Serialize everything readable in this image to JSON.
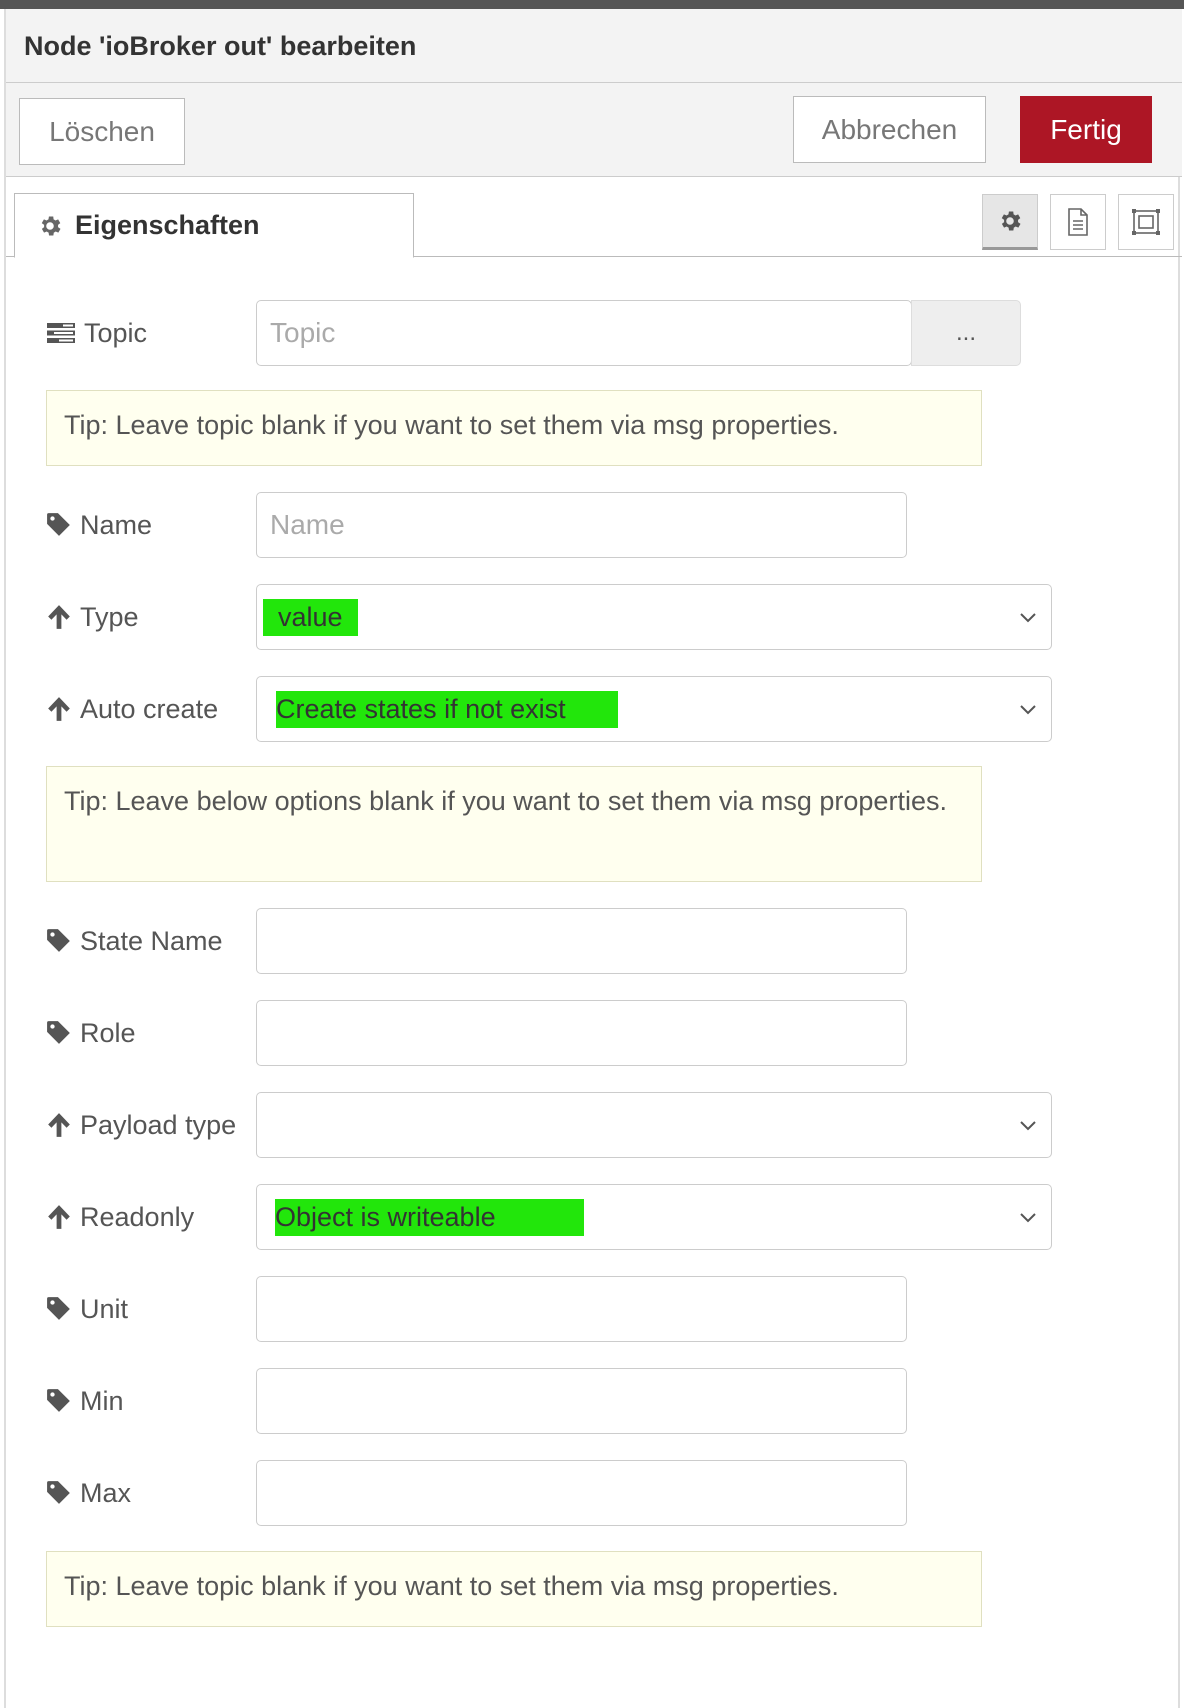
{
  "dialog": {
    "title": "Node 'ioBroker out' bearbeiten",
    "delete_label": "Löschen",
    "cancel_label": "Abbrechen",
    "done_label": "Fertig",
    "accent_color": "#ad1625"
  },
  "tabs": {
    "properties_label": "Eigenschaften",
    "toolbar_icons": [
      "gear-icon",
      "document-icon",
      "frame-icon"
    ]
  },
  "form": {
    "topic": {
      "label": "Topic",
      "placeholder": "Topic",
      "browse_label": "..."
    },
    "tip1": "Tip: Leave topic blank if you want to set them via msg properties.",
    "name": {
      "label": "Name",
      "placeholder": "Name"
    },
    "type": {
      "label": "Type",
      "value": "value"
    },
    "auto_create": {
      "label": "Auto create",
      "value": "Create states if not exist"
    },
    "tip2": "Tip: Leave below options blank if you want to set them via msg properties.",
    "state_name": {
      "label": "State Name",
      "value": ""
    },
    "role": {
      "label": "Role",
      "value": ""
    },
    "payload_type": {
      "label": "Payload type",
      "value": ""
    },
    "readonly": {
      "label": "Readonly",
      "value": "Object is writeable"
    },
    "unit": {
      "label": "Unit",
      "value": ""
    },
    "min": {
      "label": "Min",
      "value": ""
    },
    "max": {
      "label": "Max",
      "value": ""
    },
    "tip3": "Tip: Leave topic blank if you want to set them via msg properties.",
    "highlight_color": "#22e60b"
  }
}
